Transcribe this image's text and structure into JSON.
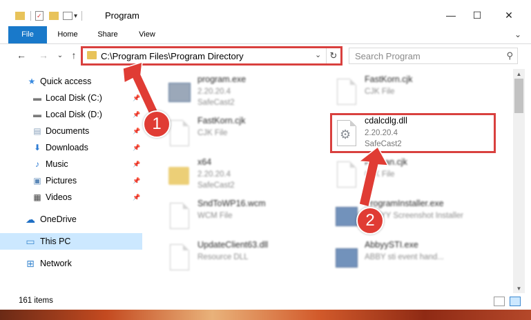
{
  "window": {
    "title": "Program",
    "minimize_glyph": "—",
    "maximize_glyph": "☐",
    "close_glyph": "✕"
  },
  "ribbon": {
    "tabs": [
      "File",
      "Home",
      "Share",
      "View"
    ]
  },
  "address": {
    "path": "C:\\Program Files\\Program Directory",
    "dropdown_glyph": "⌄",
    "refresh_glyph": "↻"
  },
  "search": {
    "placeholder": "Search Program",
    "icon_glyph": "⚲"
  },
  "nav_buttons": {
    "back": "←",
    "forward": "→",
    "recent": "⌄",
    "up": "↑"
  },
  "navpane": {
    "items": [
      {
        "label": "Quick access",
        "icon": "star-icon",
        "glyph": "★",
        "color": "#3a8be0"
      },
      {
        "label": "Local Disk (C:)",
        "icon": "drive-icon",
        "glyph": "▬",
        "color": "#7a7a7a"
      },
      {
        "label": "Local Disk (D:)",
        "icon": "drive-icon",
        "glyph": "▬",
        "color": "#7a7a7a"
      },
      {
        "label": "Documents",
        "icon": "documents-icon",
        "glyph": "▤",
        "color": "#8aa2bc"
      },
      {
        "label": "Downloads",
        "icon": "download-icon",
        "glyph": "⬇",
        "color": "#2d7bd3"
      },
      {
        "label": "Music",
        "icon": "music-icon",
        "glyph": "♪",
        "color": "#2d7bd3"
      },
      {
        "label": "Pictures",
        "icon": "pictures-icon",
        "glyph": "▣",
        "color": "#5d89b8"
      },
      {
        "label": "Videos",
        "icon": "videos-icon",
        "glyph": "▦",
        "color": "#444"
      },
      {
        "label": "OneDrive",
        "icon": "cloud-icon",
        "glyph": "☁",
        "color": "#1f6fc4"
      },
      {
        "label": "This PC",
        "icon": "computer-icon",
        "glyph": "▭",
        "color": "#3a87cf"
      },
      {
        "label": "Network",
        "icon": "network-icon",
        "glyph": "⊞",
        "color": "#3a87cf"
      }
    ],
    "pin_glyph": "📌"
  },
  "files": [
    {
      "name": "program.exe",
      "line2": "2.20.20.4",
      "line3": "SafeCast2",
      "kind": "exe"
    },
    {
      "name": "FastKorn.cjk",
      "line2": "CJK File",
      "line3": "",
      "kind": "doc"
    },
    {
      "name": "FastKorn.cjk",
      "line2": "CJK File",
      "line3": "",
      "kind": "doc"
    },
    {
      "name": "cdalcdlg.dll",
      "line2": "2.20.20.4",
      "line3": "SafeCast2",
      "kind": "dll"
    },
    {
      "name": "x64",
      "line2": "2.20.20.4",
      "line3": "SafeCast2",
      "kind": "folder"
    },
    {
      "name": "Kor...an.cjk",
      "line2": "CJK File",
      "line3": "",
      "kind": "doc"
    },
    {
      "name": "SndToWP16.wcm",
      "line2": "WCM File",
      "line3": "",
      "kind": "doc"
    },
    {
      "name": "ProgramInstaller.exe",
      "line2": "ABBYY Screenshot Installer",
      "line3": "",
      "kind": "exe"
    },
    {
      "name": "UpdateClient63.dll",
      "line2": "Resource DLL",
      "line3": "",
      "kind": "doc"
    },
    {
      "name": "AbbyySTI.exe",
      "line2": "ABBY sti event hand...",
      "line3": "",
      "kind": "exe"
    }
  ],
  "status": {
    "items_count": "161 items"
  },
  "annotations": {
    "step1": "1",
    "step2": "2",
    "color": "#e03c34"
  }
}
